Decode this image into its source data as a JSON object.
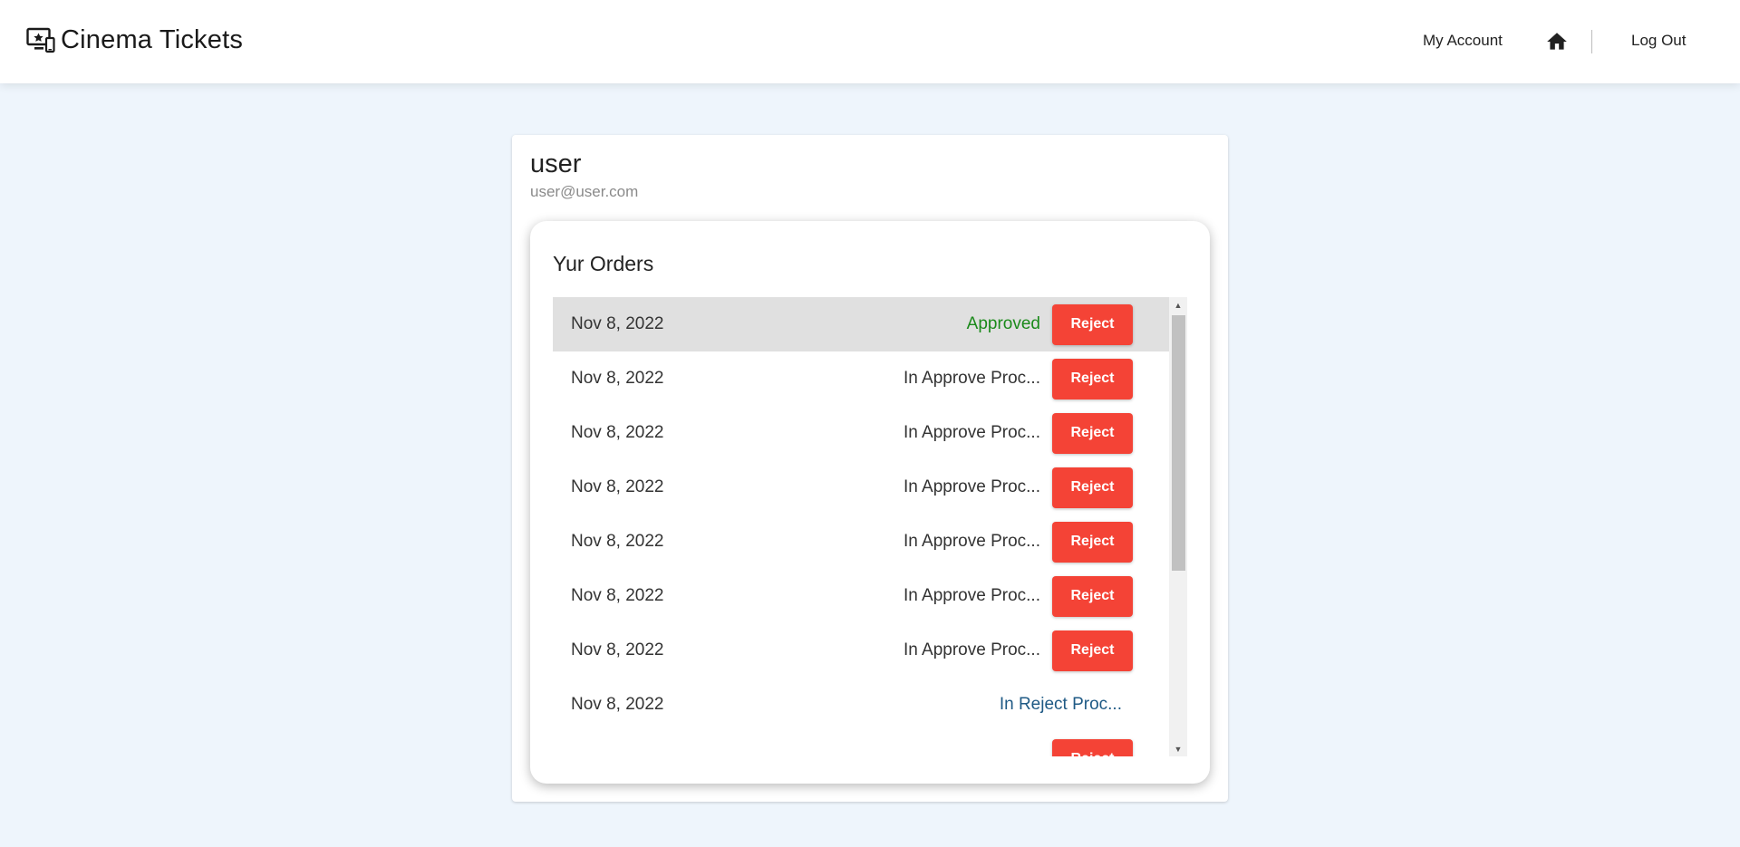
{
  "header": {
    "brand_title": "Cinema Tickets",
    "brand_icon": "cinema-screen-icon",
    "nav_account": "My Account",
    "home_icon": "home-icon",
    "nav_logout": "Log Out"
  },
  "profile": {
    "name": "user",
    "email": "user@user.com"
  },
  "orders": {
    "title": "Yur Orders",
    "reject_label": "Reject",
    "items": [
      {
        "date": "Nov 8, 2022",
        "status": "Approved",
        "has_reject": true
      },
      {
        "date": "Nov 8, 2022",
        "status": "In Approve Proc...",
        "has_reject": true
      },
      {
        "date": "Nov 8, 2022",
        "status": "In Approve Proc...",
        "has_reject": true
      },
      {
        "date": "Nov 8, 2022",
        "status": "In Approve Proc...",
        "has_reject": true
      },
      {
        "date": "Nov 8, 2022",
        "status": "In Approve Proc...",
        "has_reject": true
      },
      {
        "date": "Nov 8, 2022",
        "status": "In Approve Proc...",
        "has_reject": true
      },
      {
        "date": "Nov 8, 2022",
        "status": "In Approve Proc...",
        "has_reject": true
      },
      {
        "date": "Nov 8, 2022",
        "status": "In Reject Proc...",
        "has_reject": false
      },
      {
        "date": "",
        "status": "",
        "has_reject": true
      }
    ]
  },
  "colors": {
    "approved": "#1b8a1b",
    "in_reject_process": "#1f5a85",
    "reject_button": "#f44336",
    "page_background": "#eef5fc"
  }
}
